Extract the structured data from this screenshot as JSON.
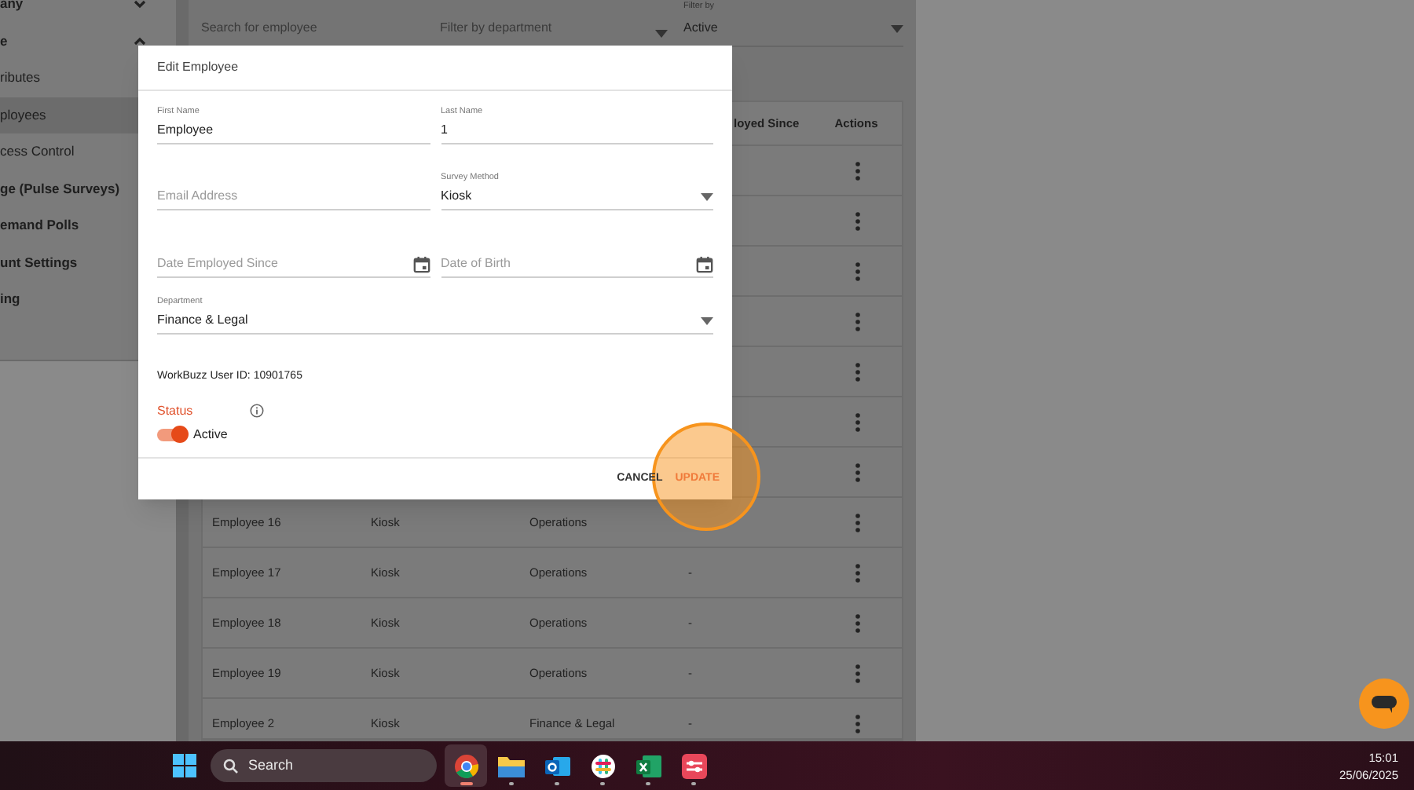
{
  "sidebar": {
    "items": [
      {
        "label": "any",
        "kind": "group",
        "expanded": false,
        "selected": false
      },
      {
        "label": "e",
        "kind": "group",
        "expanded": true,
        "selected": false
      },
      {
        "label": "ributes",
        "kind": "sub",
        "selected": false
      },
      {
        "label": "ployees",
        "kind": "sub",
        "selected": true
      },
      {
        "label": "cess Control",
        "kind": "sub",
        "selected": false
      },
      {
        "label": "ge (Pulse Surveys)",
        "kind": "page",
        "selected": false
      },
      {
        "label": "emand Polls",
        "kind": "page",
        "selected": false
      },
      {
        "label": "unt Settings",
        "kind": "page",
        "selected": false
      },
      {
        "label": "ing",
        "kind": "page",
        "selected": false
      }
    ]
  },
  "filters": {
    "search": {
      "placeholder": "Search for employee"
    },
    "department": {
      "placeholder": "Filter by department"
    },
    "status": {
      "label": "Filter by",
      "value": "Active"
    }
  },
  "table": {
    "columns": [
      {
        "label": "loyed Since"
      },
      {
        "label": "Actions"
      }
    ],
    "rows": [
      {
        "name": "Employee 16",
        "survey_method": "Kiosk",
        "department": "Operations",
        "employed_since": ""
      },
      {
        "name": "Employee 17",
        "survey_method": "Kiosk",
        "department": "Operations",
        "employed_since": "-"
      },
      {
        "name": "Employee 18",
        "survey_method": "Kiosk",
        "department": "Operations",
        "employed_since": "-"
      },
      {
        "name": "Employee 19",
        "survey_method": "Kiosk",
        "department": "Operations",
        "employed_since": "-"
      },
      {
        "name": "Employee 2",
        "survey_method": "Kiosk",
        "department": "Finance & Legal",
        "employed_since": "-"
      }
    ]
  },
  "dialog": {
    "title": "Edit Employee",
    "first_name": {
      "label": "First Name",
      "value": "Employee"
    },
    "last_name": {
      "label": "Last Name",
      "value": "1"
    },
    "email": {
      "placeholder": "Email Address"
    },
    "survey_method": {
      "label": "Survey Method",
      "value": "Kiosk"
    },
    "date_employed": {
      "placeholder": "Date Employed Since"
    },
    "date_of_birth": {
      "placeholder": "Date of Birth"
    },
    "department": {
      "label": "Department",
      "value": "Finance & Legal"
    },
    "user_id": "WorkBuzz User ID: 10901765",
    "status": {
      "label": "Status",
      "on": true,
      "switch_label": "Active"
    },
    "buttons": [
      {
        "label": "CANCEL",
        "kind": "secondary"
      },
      {
        "label": "UPDATE",
        "kind": "primary"
      }
    ]
  },
  "taskbar": {
    "search": {
      "placeholder": "Search"
    },
    "apps": [
      {
        "kind": "browser",
        "selected": true
      },
      {
        "kind": "folder",
        "selected": false
      },
      {
        "kind": "mail",
        "selected": false
      },
      {
        "kind": "hash",
        "selected": false
      },
      {
        "kind": "spreadsheet",
        "selected": false
      },
      {
        "kind": "slides",
        "selected": false
      }
    ],
    "time": "15:01",
    "date": "25/06/2025"
  }
}
